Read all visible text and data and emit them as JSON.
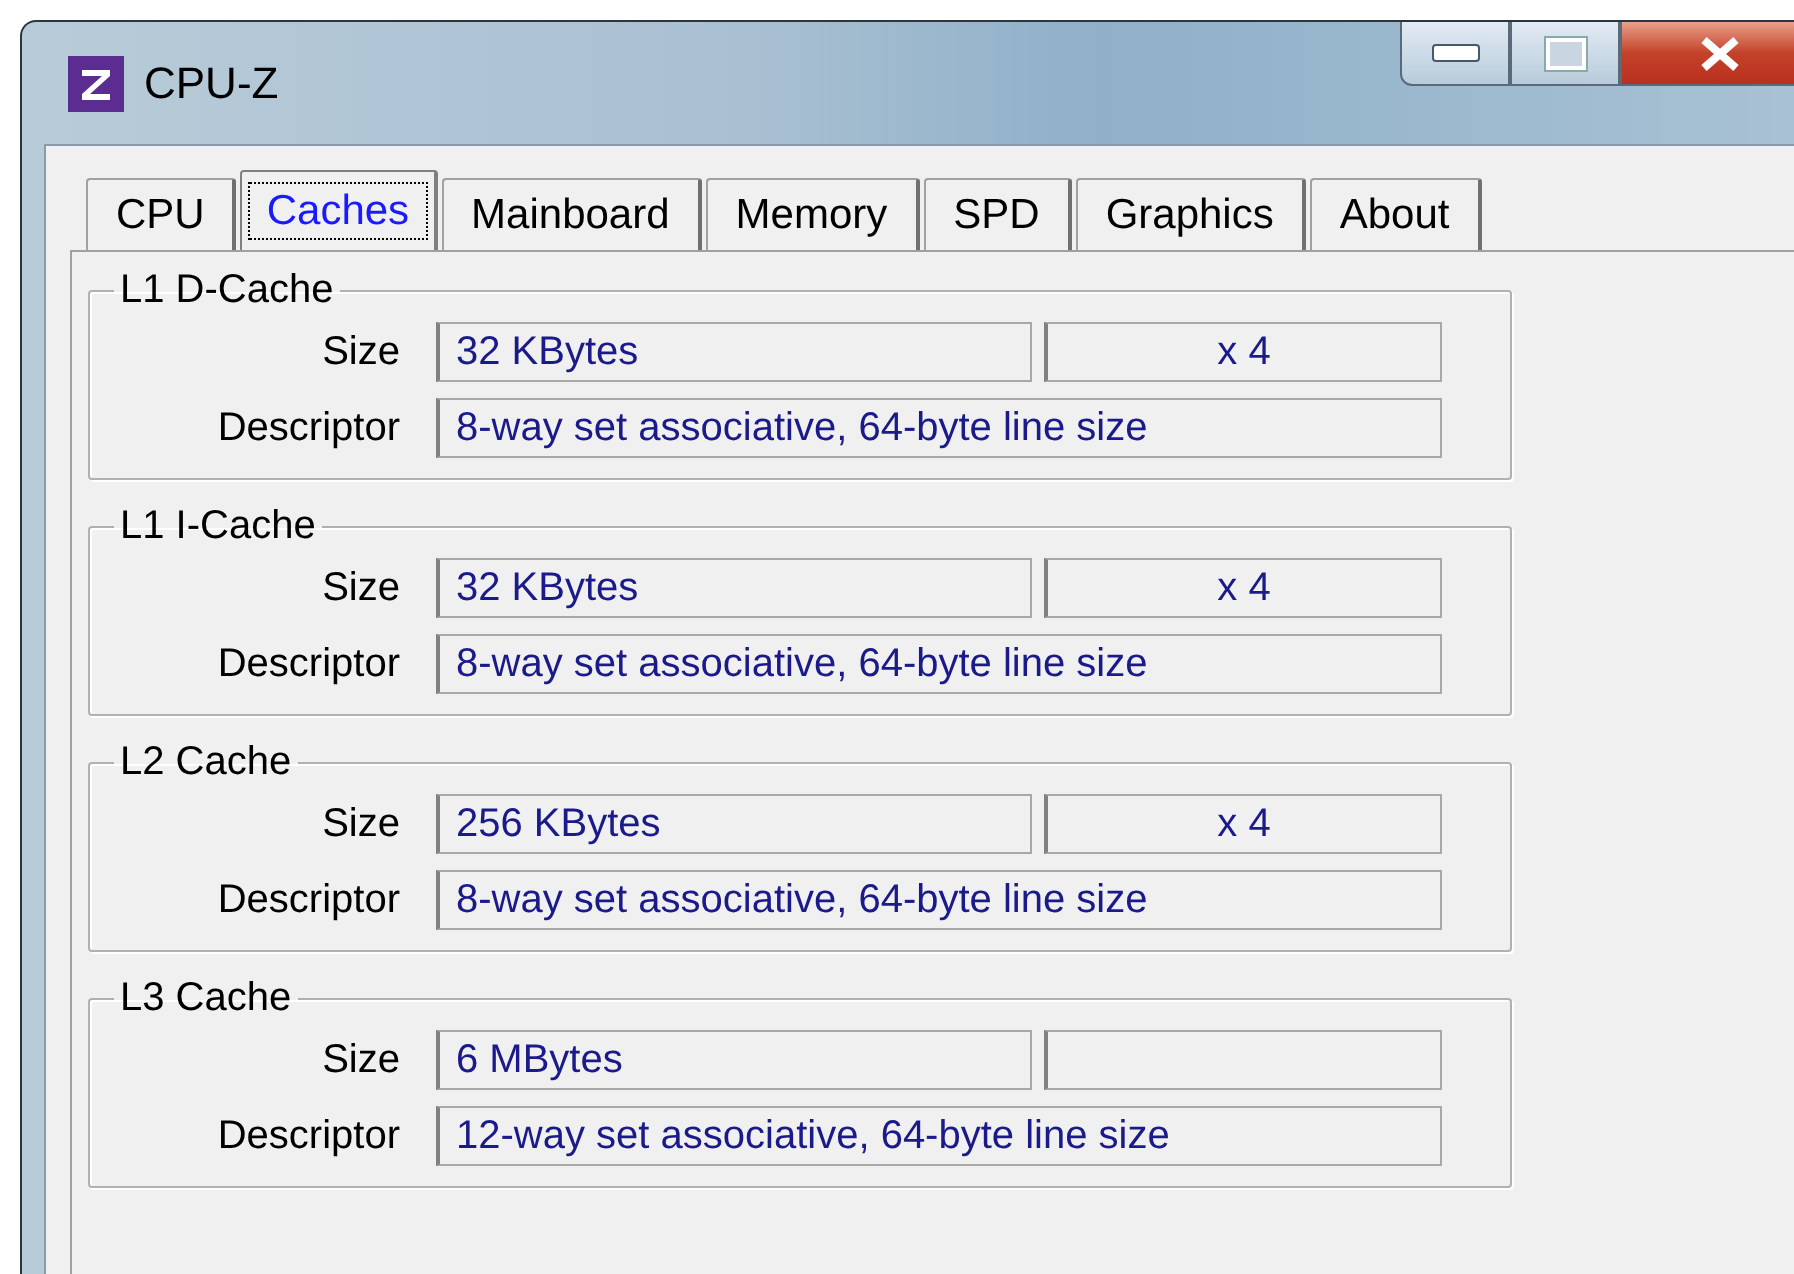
{
  "window": {
    "title": "CPU-Z"
  },
  "tabs": [
    {
      "label": "CPU",
      "selected": false
    },
    {
      "label": "Caches",
      "selected": true
    },
    {
      "label": "Mainboard",
      "selected": false
    },
    {
      "label": "Memory",
      "selected": false
    },
    {
      "label": "SPD",
      "selected": false
    },
    {
      "label": "Graphics",
      "selected": false
    },
    {
      "label": "About",
      "selected": false
    }
  ],
  "groups": [
    {
      "title": "L1 D-Cache",
      "rows": [
        {
          "kind": "split",
          "label": "Size",
          "value": "32 KBytes",
          "count": "x 4"
        },
        {
          "kind": "wide",
          "label": "Descriptor",
          "value": "8-way set associative, 64-byte line size"
        }
      ]
    },
    {
      "title": "L1 I-Cache",
      "rows": [
        {
          "kind": "split",
          "label": "Size",
          "value": "32 KBytes",
          "count": "x 4"
        },
        {
          "kind": "wide",
          "label": "Descriptor",
          "value": "8-way set associative, 64-byte line size"
        }
      ]
    },
    {
      "title": "L2 Cache",
      "rows": [
        {
          "kind": "split",
          "label": "Size",
          "value": "256 KBytes",
          "count": "x 4"
        },
        {
          "kind": "wide",
          "label": "Descriptor",
          "value": "8-way set associative, 64-byte line size"
        }
      ]
    },
    {
      "title": "L3 Cache",
      "rows": [
        {
          "kind": "split",
          "label": "Size",
          "value": "6 MBytes"
        },
        {
          "kind": "wide",
          "label": "Descriptor",
          "value": "12-way set associative, 64-byte line size"
        }
      ]
    }
  ]
}
